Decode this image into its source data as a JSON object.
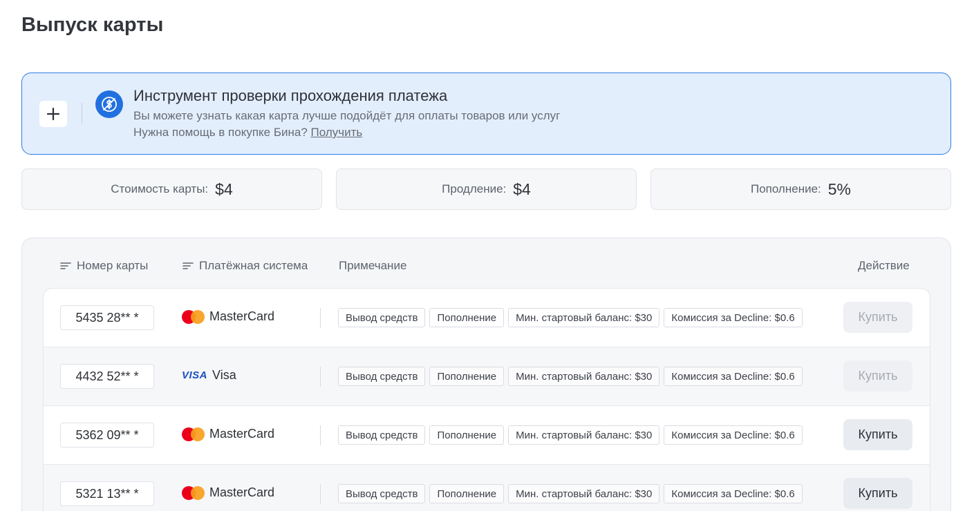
{
  "page": {
    "title": "Выпуск карты"
  },
  "banner": {
    "add_icon": "plus-icon",
    "icon": "dollar-crossed-icon",
    "title": "Инструмент проверки прохождения платежа",
    "line1": "Вы можете узнать какая карта лучше подойдёт для оплаты товаров или услуг",
    "line2_text": "Нужна помощь в покупке Бина?",
    "line2_link": "Получить",
    "accent_color": "#2270e0"
  },
  "stats": [
    {
      "label": "Стоимость карты:",
      "value": "$4"
    },
    {
      "label": "Продление:",
      "value": "$4"
    },
    {
      "label": "Пополнение:",
      "value": "5%"
    }
  ],
  "table": {
    "headers": {
      "card_number": "Номер карты",
      "payment_system": "Платёжная система",
      "note": "Примечание",
      "action": "Действие"
    },
    "rows": [
      {
        "card": "5435 28** *",
        "brand": "MasterCard",
        "brand_icon": "mastercard-icon",
        "tags": [
          "Вывод средств",
          "Пополнение",
          "Мин. стартовый баланс: $30",
          "Комиссия за Decline: $0.6"
        ],
        "button": "Купить",
        "enabled": false
      },
      {
        "card": "4432 52** *",
        "brand": "Visa",
        "brand_icon": "visa-icon",
        "brand_logo_text": "VISA",
        "tags": [
          "Вывод средств",
          "Пополнение",
          "Мин. стартовый баланс: $30",
          "Комиссия за Decline: $0.6"
        ],
        "button": "Купить",
        "enabled": false
      },
      {
        "card": "5362 09** *",
        "brand": "MasterCard",
        "brand_icon": "mastercard-icon",
        "tags": [
          "Вывод средств",
          "Пополнение",
          "Мин. стартовый баланс: $30",
          "Комиссия за Decline: $0.6"
        ],
        "button": "Купить",
        "enabled": true
      },
      {
        "card": "5321 13** *",
        "brand": "MasterCard",
        "brand_icon": "mastercard-icon",
        "tags": [
          "Вывод средств",
          "Пополнение",
          "Мин. стартовый баланс: $30",
          "Комиссия за Decline: $0.6"
        ],
        "button": "Купить",
        "enabled": true
      }
    ]
  }
}
